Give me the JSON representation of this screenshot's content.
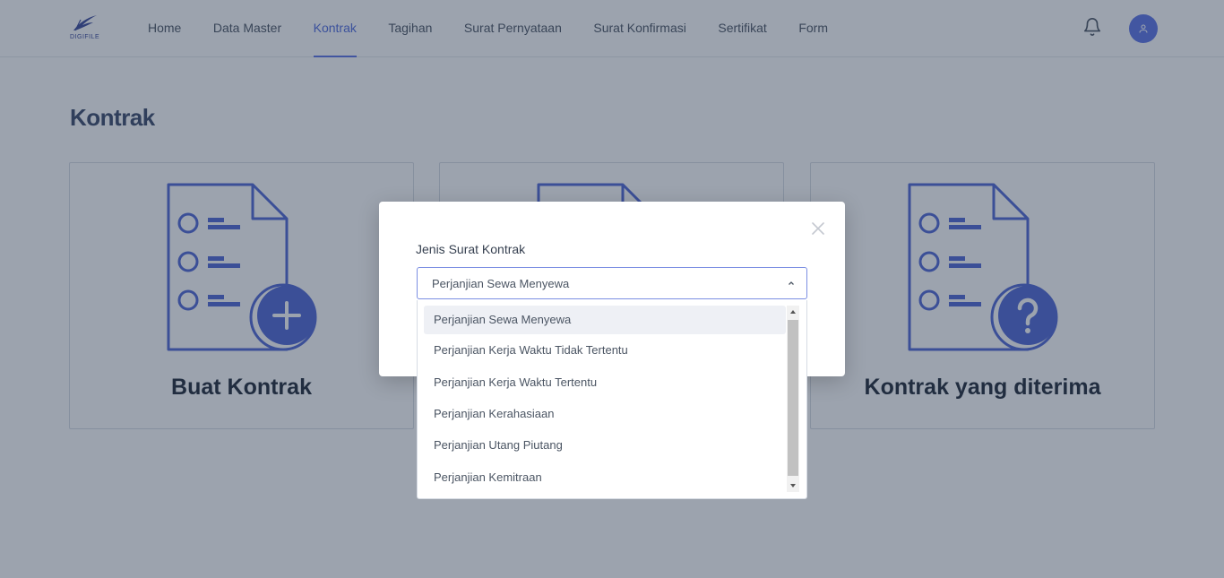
{
  "app": {
    "logo_text": "DIGIFILE"
  },
  "nav": {
    "items": [
      {
        "label": "Home"
      },
      {
        "label": "Data Master"
      },
      {
        "label": "Kontrak"
      },
      {
        "label": "Tagihan"
      },
      {
        "label": "Surat Pernyataan"
      },
      {
        "label": "Surat Konfirmasi"
      },
      {
        "label": "Sertifikat"
      },
      {
        "label": "Form"
      }
    ],
    "active": "Kontrak"
  },
  "page": {
    "title": "Kontrak"
  },
  "cards": [
    {
      "label": "Buat Kontrak",
      "icon": "document-add-icon"
    },
    {
      "label": "",
      "icon": "document-icon"
    },
    {
      "label": "Kontrak yang diterima",
      "icon": "document-question-icon"
    }
  ],
  "modal": {
    "field_label": "Jenis Surat Kontrak",
    "selected_value": "Perjanjian Sewa Menyewa",
    "options": [
      "Perjanjian Sewa Menyewa",
      "Perjanjian Kerja Waktu Tidak Tertentu",
      "Perjanjian Kerja Waktu Tertentu",
      "Perjanjian Kerahasiaan",
      "Perjanjian Utang Piutang",
      "Perjanjian Kemitraan"
    ]
  },
  "colors": {
    "accent": "#5a72e6",
    "icon_stroke": "#4f66d6",
    "icon_fill": "#4f66d6"
  }
}
